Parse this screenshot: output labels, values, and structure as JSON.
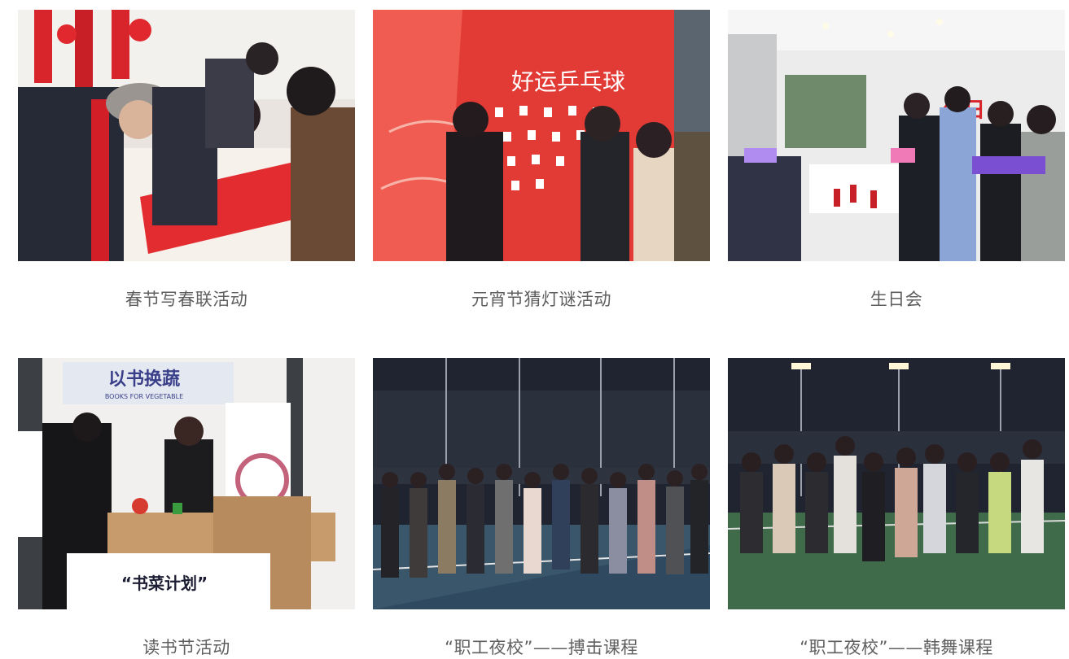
{
  "gallery": {
    "items": [
      {
        "caption": "春节写春联活动"
      },
      {
        "caption": "元宵节猜灯谜活动",
        "photo_text": "好运乒乓球"
      },
      {
        "caption": "生日会",
        "photo_text": "生日"
      },
      {
        "caption": "读书节活动",
        "photo_text": "以书换蔬",
        "photo_subtext": "BOOKS FOR VEGETABLE",
        "photo_text2": "“书菜计划”"
      },
      {
        "caption": "“职工夜校”——搏击课程"
      },
      {
        "caption": "“职工夜校”——韩舞课程"
      }
    ]
  },
  "colors": {
    "caption": "#5f5f5f",
    "festival_red": "#d8252b",
    "night_sky": "#1f2430",
    "court_green": "#3f6b4a"
  }
}
